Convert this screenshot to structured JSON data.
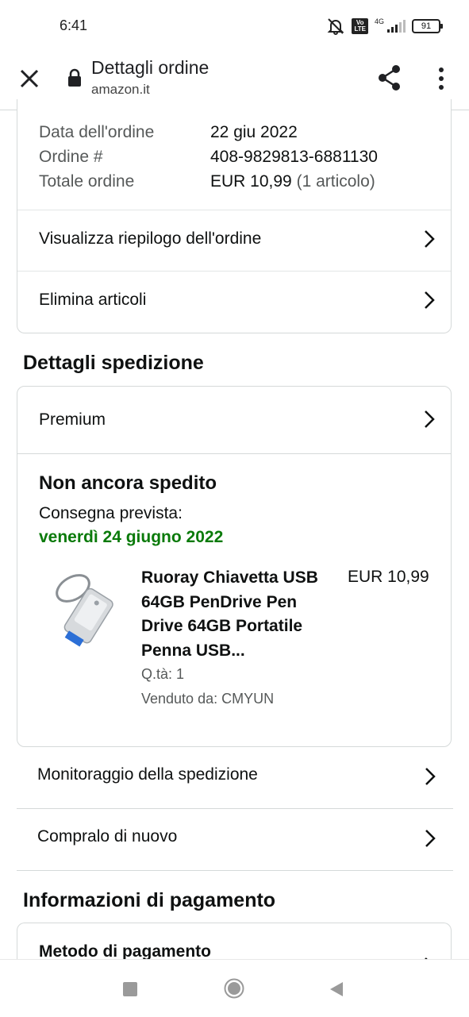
{
  "status_bar": {
    "time": "6:41",
    "network": "4G",
    "volte": "Vo\nLTE",
    "battery": "91"
  },
  "header": {
    "title": "Dettagli ordine",
    "url": "amazon.it"
  },
  "order_info": {
    "date_label": "Data dell'ordine",
    "date_value": "22 giu 2022",
    "number_label": "Ordine #",
    "number_value": "408-9829813-6881130",
    "total_label": "Totale ordine",
    "total_value": "EUR 10,99",
    "total_items": "(1 articolo)"
  },
  "order_actions": [
    {
      "label": "Visualizza riepilogo dell'ordine"
    },
    {
      "label": "Elimina articoli"
    }
  ],
  "shipping": {
    "section_title": "Dettagli spedizione",
    "method": "Premium",
    "status": "Non ancora spedito",
    "delivery_label": "Consegna prevista:",
    "delivery_date": "venerdì 24 giugno 2022",
    "product": {
      "title": "Ruoray Chiavetta USB 64GB PenDrive Pen Drive 64GB Portatile Penna USB...",
      "price": "EUR 10,99",
      "quantity": "Q.tà: 1",
      "seller": "Venduto da: CMYUN"
    },
    "actions": [
      {
        "label": "Monitoraggio della spedizione"
      },
      {
        "label": "Compralo di nuovo"
      }
    ]
  },
  "payment": {
    "section_title": "Informazioni di pagamento",
    "method_label": "Metodo di pagamento"
  },
  "colors": {
    "delivery_green": "#0a7a0a",
    "border": "#d5d9d9",
    "muted_text": "#565959"
  }
}
